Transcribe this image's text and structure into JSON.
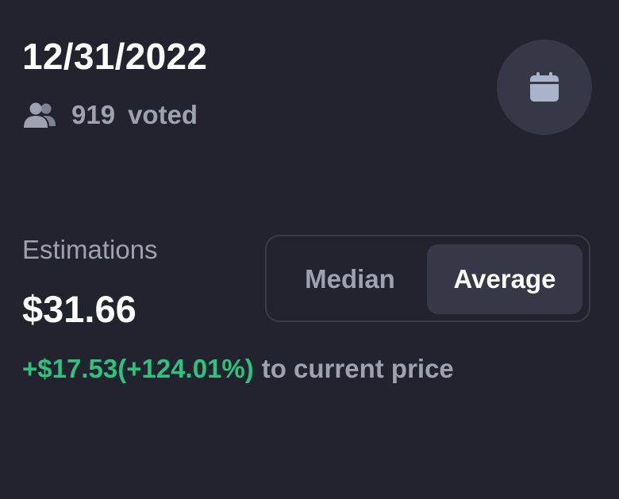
{
  "header": {
    "date": "12/31/2022",
    "votes": {
      "count": "919",
      "label": "voted",
      "icon": "users-icon"
    },
    "calendar_button": {
      "icon": "calendar-icon"
    }
  },
  "estimations": {
    "label": "Estimations",
    "value": "$31.66",
    "change": "+$17.53(+124.01%)",
    "change_suffix": "to current price",
    "toggle": {
      "options": [
        "Median",
        "Average"
      ],
      "selected": "Average"
    }
  },
  "colors": {
    "background": "#22232f",
    "surface": "#363847",
    "text_primary": "#ffffff",
    "text_secondary": "#9ea1b0",
    "positive": "#2ec27e"
  }
}
